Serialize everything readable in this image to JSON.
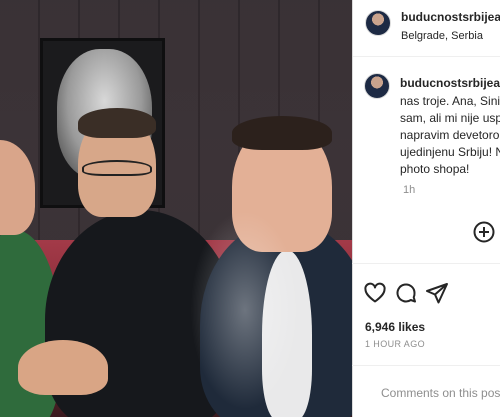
{
  "post": {
    "username": "buducnostsrbijeav",
    "location": "Belgrade, Serbia",
    "caption_lines": [
      "nas troje. Ana, Siniša",
      "sam, ali mi nije uspe",
      "napravim devetoro.",
      "ujedinjenu Srbiju! N",
      "photo shopa!"
    ],
    "caption_time": "1h",
    "likes": "6,946 likes",
    "time_ago": "1 HOUR AGO",
    "comment_placeholder": "Comments on this post h"
  },
  "icons": {
    "add": "plus-circle-icon",
    "like": "heart-icon",
    "comment": "comment-bubble-icon",
    "share": "paper-plane-icon"
  },
  "colors": {
    "text": "#262626",
    "muted": "#8e8e8e",
    "border": "#dbdbdb"
  }
}
